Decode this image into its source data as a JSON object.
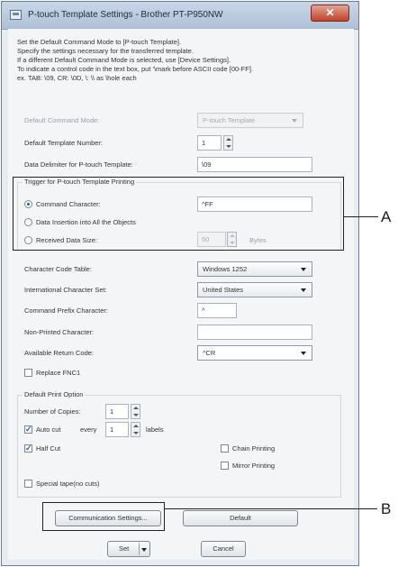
{
  "window": {
    "title": "P-touch Template Settings - Brother PT-P950NW",
    "close_glyph": "✕"
  },
  "description": [
    "Set the Default Command Mode to [P-touch Template].",
    "Specify the settings necessary for the transferred template.",
    "If a different Default Command Mode is selected, use [Device Settings].",
    "To indicate a control code in the text box, put '\\mark before ASCII code [00-FF].",
    "    ex. TAB: \\09,  CR: \\0D,  \\: \\\\  as  \\hole each"
  ],
  "fields": {
    "default_command_mode": {
      "label": "Default Command Mode:",
      "value": "P-touch Template"
    },
    "default_template_number": {
      "label": "Default Template Number:",
      "value": "1"
    },
    "data_delimiter": {
      "label": "Data Delimiter for P-touch Template:",
      "value": "\\09"
    }
  },
  "trigger_group": {
    "title": "Trigger for P-touch Template Printing",
    "command_character": {
      "label": "Command Character:",
      "value": "^FF"
    },
    "data_insertion": {
      "label": "Data Insertion into All the Objects"
    },
    "received_data_size": {
      "label": "Received Data Size:",
      "value": "50",
      "unit": "Bytes"
    }
  },
  "settings": {
    "character_code_table": {
      "label": "Character Code Table:",
      "value": "Windows 1252"
    },
    "international_character_set": {
      "label": "International Character Set:",
      "value": "United States"
    },
    "command_prefix_character": {
      "label": "Command Prefix Character:",
      "value": "^"
    },
    "non_printed_character": {
      "label": "Non-Printed Character:",
      "value": ""
    },
    "available_return_code": {
      "label": "Available Return Code:",
      "value": "^CR"
    },
    "replace_fnc1": {
      "label": "Replace FNC1"
    }
  },
  "print_option": {
    "title": "Default Print Option",
    "number_of_copies": {
      "label": "Number of Copies:",
      "value": "1"
    },
    "auto_cut": {
      "label": "Auto cut",
      "every_label": "every",
      "value": "1",
      "unit": "labels"
    },
    "half_cut": {
      "label": "Half Cut"
    },
    "chain_printing": {
      "label": "Chain Printing"
    },
    "mirror_printing": {
      "label": "Mirror Printing"
    },
    "special_tape": {
      "label": "Special tape(no cuts)"
    }
  },
  "buttons": {
    "communication_settings": "Communication Settings...",
    "default": "Default",
    "set": "Set",
    "cancel": "Cancel"
  },
  "callouts": {
    "a": "A",
    "b": "B"
  },
  "check_glyph": "✓"
}
